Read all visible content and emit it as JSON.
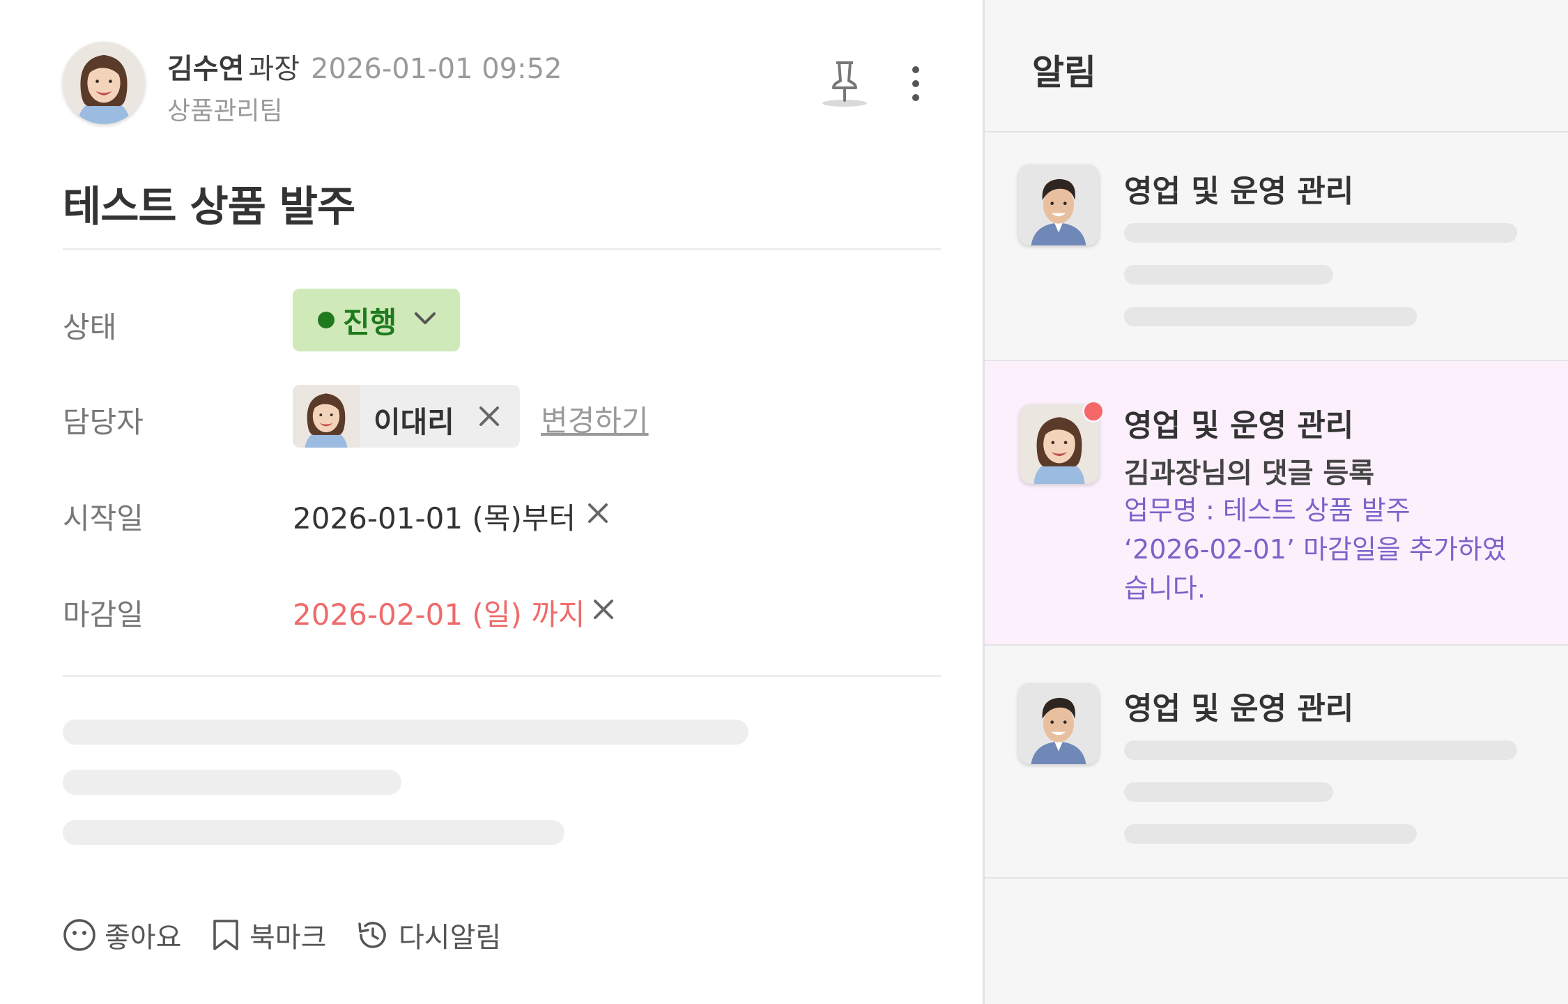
{
  "task": {
    "author": {
      "name": "김수연",
      "rank": "과장",
      "time": "2026-01-01 09:52",
      "team": "상품관리팀"
    },
    "title": "테스트 상품 발주",
    "fields": {
      "status_label": "상태",
      "status_value": "진행",
      "assignee_label": "담당자",
      "assignee_name": "이대리",
      "change_link": "변경하기",
      "start_label": "시작일",
      "start_value": "2026-01-01 (목)부터",
      "due_label": "마감일",
      "due_value": "2026-02-01 (일) 까지"
    },
    "actions": {
      "like": "좋아요",
      "bookmark": "북마크",
      "remind": "다시알림"
    },
    "icons": [
      "pin-icon",
      "more-vertical-icon",
      "chevron-down-icon",
      "close-icon",
      "smile-icon",
      "bookmark-icon",
      "remind-icon"
    ]
  },
  "notifications": {
    "title": "알림",
    "items": [
      {
        "title": "영업 및 운영 관리"
      },
      {
        "title": "영업 및 운영 관리",
        "subtitle": "김과장님의 댓글 등록",
        "line1": "업무명 : 테스트 상품 발주",
        "line2": "‘2026-02-01’ 마감일을 추가하였습니다."
      },
      {
        "title": "영업 및 운영 관리"
      }
    ]
  },
  "colors": {
    "status_bg": "#cfe9b8",
    "status_text": "#1f7a1f",
    "due_text": "#ef6a6a",
    "highlight_bg": "#fbf0fc",
    "notice_text": "#7a63c8",
    "unread_dot": "#f46868"
  }
}
